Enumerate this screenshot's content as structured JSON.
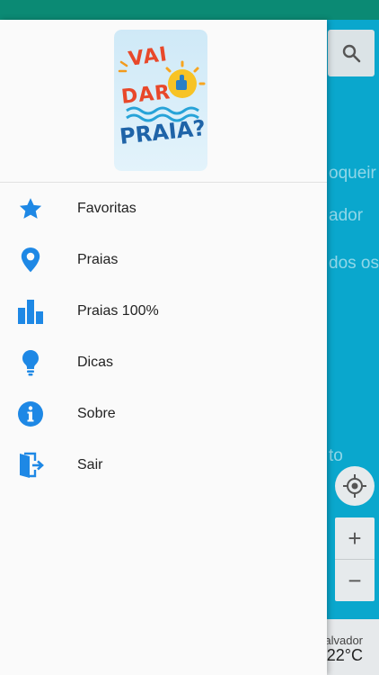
{
  "background": {
    "text_lines": [
      "oqueir",
      "ador",
      "dos os",
      "to"
    ],
    "weather": {
      "city": "alvador",
      "temp": "/22°C"
    }
  },
  "drawer": {
    "logo": {
      "lines": [
        "VAI",
        "DAR",
        "PRAIA?"
      ],
      "icon": "thumbs-up-sun-icon"
    },
    "menu": [
      {
        "label": "Favoritas",
        "icon": "star-icon"
      },
      {
        "label": "Praias",
        "icon": "map-pin-icon"
      },
      {
        "label": "Praias 100%",
        "icon": "bar-chart-icon"
      },
      {
        "label": "Dicas",
        "icon": "lightbulb-icon"
      },
      {
        "label": "Sobre",
        "icon": "info-icon"
      },
      {
        "label": "Sair",
        "icon": "exit-icon"
      }
    ]
  },
  "colors": {
    "accent": "#1e88e5",
    "status_bar": "#0b8a74",
    "map_background": "#0aa7cd"
  }
}
